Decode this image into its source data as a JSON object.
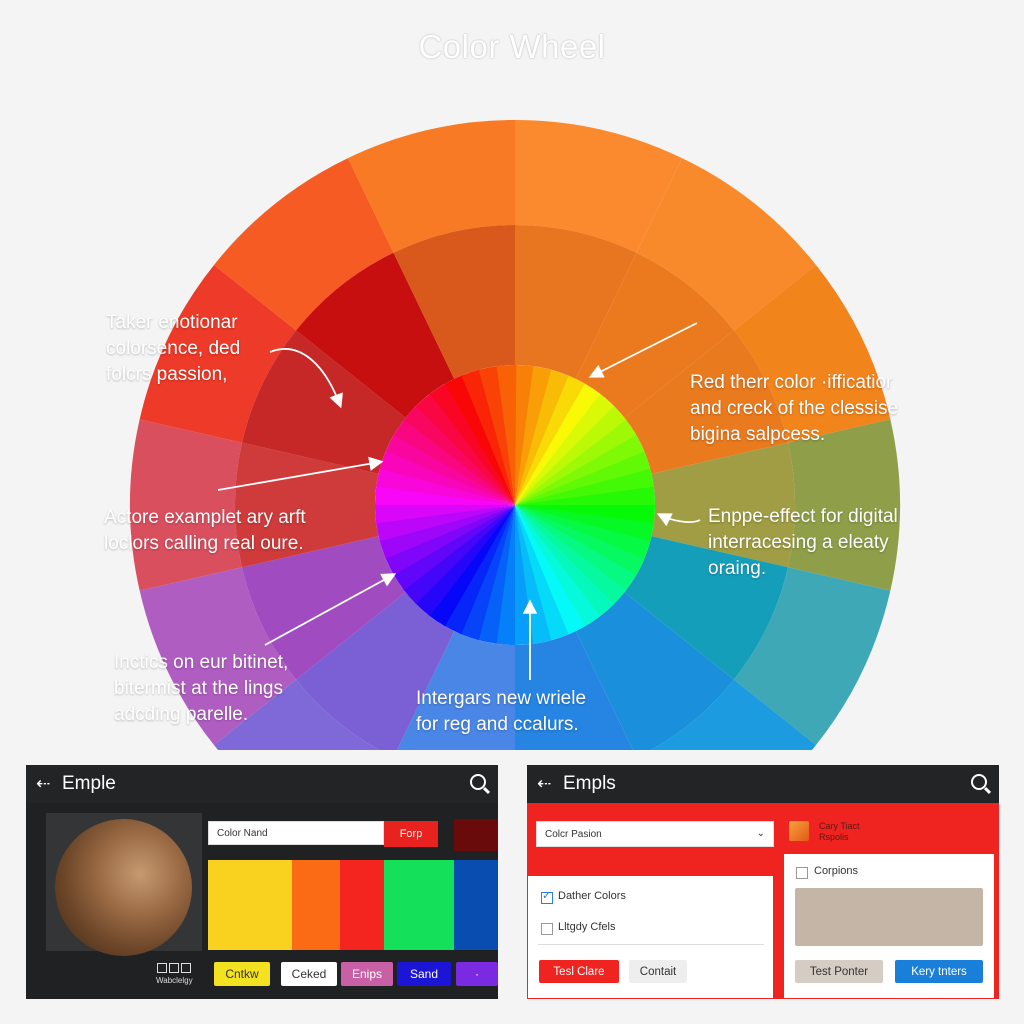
{
  "title": "Color Wheel",
  "annotations": {
    "top_left": [
      "Takег enotionar",
      "colorsence, ded",
      "folcrs passion,"
    ],
    "mid_left": [
      "Actore examplet ary arft",
      "loclors calling real oure."
    ],
    "bottom_left": [
      "Inctics on eur bitinet,",
      "bitermist at the lings",
      "adcding parelle."
    ],
    "top_right": [
      "Red therr color ·ifficatior",
      "and creck of the clessise",
      "bigina salpcess."
    ],
    "mid_right": [
      "Enppe-effect for digital",
      "interracesing a eleaty",
      "oraing."
    ],
    "bottom_center": [
      "Intergars new wriele",
      "for reg and ccalurs."
    ]
  },
  "wheel_colors": {
    "outer": [
      "#4a86e6",
      "#7f69d8",
      "#b05dc2",
      "#d94f5e",
      "#ee3a28",
      "#f55b22",
      "#f97a25",
      "#fb8a2f",
      "#f98a2c",
      "#f2841c",
      "#8f9e49",
      "#3fa8b7",
      "#1c9be0",
      "#2a8fe3"
    ],
    "middle": [
      "#4a86e6",
      "#7a5fd5",
      "#a04bc0",
      "#cf3a3a",
      "#c62727",
      "#c80f10",
      "#d9591c",
      "#e87620",
      "#eb7a1e",
      "#ea7a1e",
      "#a09d44",
      "#159eba",
      "#1a8fdc",
      "#2684e2"
    ]
  },
  "left_panel": {
    "header_title": "Emple",
    "back_icon": "arrow-left-icon",
    "search_icon": "search-icon",
    "name_input_value": "Color Nand",
    "red_button_label": "Forp",
    "stripe_colors": [
      "#f8d21f",
      "#fb6b16",
      "#f4251e",
      "#14e05a",
      "#0a4db1"
    ],
    "icon_grid_label": "Wabclelgy",
    "chips": [
      {
        "label": "Cntkw",
        "bg": "#f3e21f",
        "color": "#333333"
      },
      {
        "label": "Cekеd",
        "bg": "#ffffff",
        "color": "#333333"
      },
      {
        "label": "Enips",
        "bg": "#c95fa4",
        "color": "#ffffff"
      },
      {
        "label": "Sand",
        "bg": "#1d15d6",
        "color": "#ffffff"
      },
      {
        "label": "·",
        "bg": "#7a2ae0",
        "color": "#ffffff"
      }
    ]
  },
  "right_panel": {
    "header_title": "Empls",
    "back_icon": "arrow-left-icon",
    "search_icon": "search-icon",
    "select_value": "Colcr Pasion",
    "swatch_label": [
      "Cary Tiact",
      "Rspolis"
    ],
    "checkboxes": [
      {
        "label": "Dather Colors",
        "checked": true
      },
      {
        "label": "Lltgdy Cfels",
        "checked": false
      }
    ],
    "buttons_left": [
      {
        "label": "Tesl Clare",
        "bg": "#ef2320",
        "color": "#ffffff"
      },
      {
        "label": "Contait",
        "bg": "#eeeeee",
        "color": "#333333"
      }
    ],
    "card_right": {
      "checkbox_label": "Corpions",
      "preview_color": "#c5b5a6",
      "buttons": [
        {
          "label": "Test Ponter",
          "bg": "#d5ccc3",
          "color": "#333333"
        },
        {
          "label": "Kery tnters",
          "bg": "#1a7fd9",
          "color": "#ffffff"
        }
      ]
    }
  }
}
